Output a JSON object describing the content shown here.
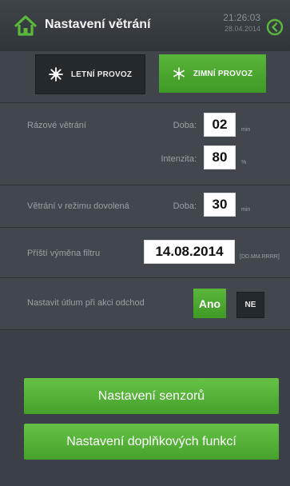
{
  "header": {
    "title": "Nastavení větrání",
    "time": "21:26:03",
    "date": "28.04.2014",
    "accent_color": "#5bb83b"
  },
  "mode": {
    "summer_label": "LETNÍ PROVOZ",
    "winter_label": "ZIMNÍ PROVOZ",
    "active": "winter"
  },
  "burst_ventilation": {
    "label": "Rázové větrání",
    "duration_label": "Doba:",
    "duration_value": "02",
    "duration_unit": "min",
    "intensity_label": "Intenzita:",
    "intensity_value": "80",
    "intensity_unit": "%"
  },
  "holiday_mode": {
    "label": "Větrání v režimu dovolená",
    "duration_label": "Doba:",
    "duration_value": "30",
    "duration_unit": "min"
  },
  "filter": {
    "label": "Příští výměna filtru",
    "value": "14.08.2014",
    "format": "[DD.MM.RRRR]"
  },
  "leave_action": {
    "label": "Nastavit útlum při akci odchod",
    "yes_label": "Ano",
    "no_label": "NE",
    "selected": "yes"
  },
  "buttons": {
    "sensors": "Nastavení senzorů",
    "extra_functions": "Nastavení doplňkových funkcí"
  }
}
